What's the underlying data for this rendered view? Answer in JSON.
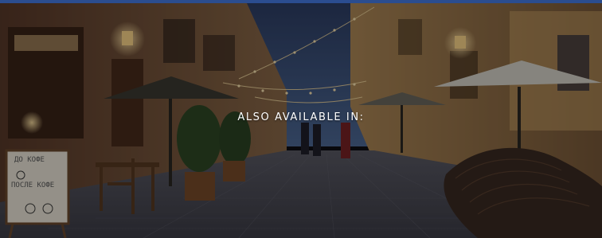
{
  "banner": {
    "heading": "ALSO AVAILABLE IN:"
  },
  "sign": {
    "line1": "ДО КОФЕ",
    "line2": "ПОСЛЕ КОФЕ"
  },
  "colors": {
    "top_bar": "#2b4d8f",
    "sky": "#3b5279",
    "lights": "#f3d9a0",
    "cobblestone": "#4a4a55"
  }
}
